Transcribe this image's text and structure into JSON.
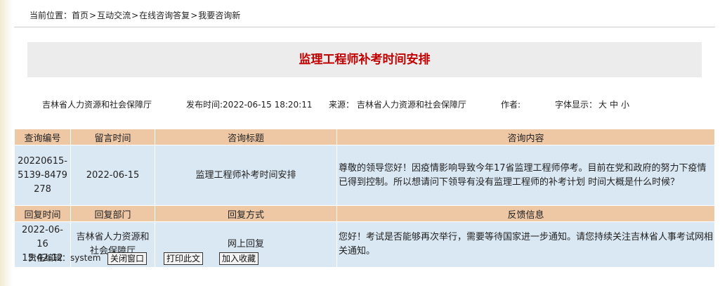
{
  "breadcrumb": {
    "prefix": "当前位置：",
    "items": [
      "首页",
      "互动交流",
      "在线咨询答复",
      "我要咨询新"
    ],
    "separator": ">"
  },
  "article": {
    "title": "监理工程师补考时间安排",
    "org": "吉林省人力资源和社会保障厅",
    "publish_label": "发布时间:",
    "publish_time": "2022-06-15 18:20:11",
    "source_label": "来源：",
    "source": "吉林省人力资源和社会保障厅",
    "author_label": "作者:",
    "author": "",
    "font_label": "字体显示：",
    "font_sizes": [
      "大",
      "中",
      "小"
    ]
  },
  "consult_table": {
    "headers": [
      "查询编号",
      "留言时间",
      "咨询标题",
      "咨询内容"
    ],
    "row": {
      "id": "20220615-5139-8479278",
      "time": "2022-06-15",
      "title": "监理工程师补考时间安排",
      "content": "尊敬的领导您好！因疫情影响导致今年17省监理工程师停考。目前在党和政府的努力下疫情已得到控制。所以想请问下领导有没有监理工程师的补考计划 时间大概是什么时候？"
    }
  },
  "reply_table": {
    "headers": [
      "回复时间",
      "回复部门",
      "回复方式",
      "反馈信息"
    ],
    "row": {
      "time": "2022-06-16 15:42:12",
      "dept": "吉林省人力资源和社会保障厅",
      "method": "网上回复",
      "feedback": "您好！考试是否能够再次举行，需要等待国家进一步通知。请您持续关注吉林省人事考试网相关通知。"
    }
  },
  "footer": {
    "editor_label": "责任编辑：",
    "editor": "system",
    "buttons": [
      "关闭窗口",
      "打印此文",
      "加入收藏"
    ]
  }
}
